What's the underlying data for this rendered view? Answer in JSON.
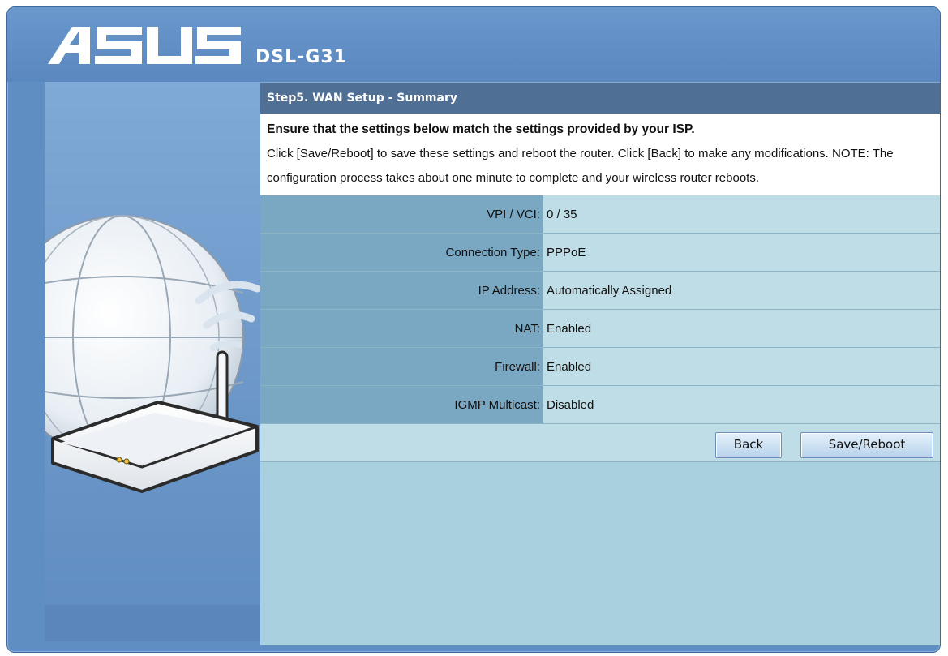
{
  "header": {
    "brand": "ASUS",
    "model": "DSL-G31"
  },
  "step": {
    "title": "Step5. WAN Setup - Summary"
  },
  "intro": {
    "headline": "Ensure that the settings below match the settings provided by your ISP.",
    "body": "Click [Save/Reboot] to save these settings and reboot the router. Click [Back] to make any modifications. NOTE: The configuration process takes about one minute to complete and your wireless router reboots."
  },
  "summary": {
    "rows": [
      {
        "label": "VPI / VCI:",
        "value": "0 / 35"
      },
      {
        "label": "Connection Type:",
        "value": "PPPoE"
      },
      {
        "label": "IP Address:",
        "value": "Automatically Assigned"
      },
      {
        "label": "NAT:",
        "value": "Enabled"
      },
      {
        "label": "Firewall:",
        "value": "Enabled"
      },
      {
        "label": "IGMP Multicast:",
        "value": "Disabled"
      }
    ]
  },
  "buttons": {
    "back_label": "Back",
    "save_label": "Save/Reboot"
  },
  "colors": {
    "header_blue": "#5f8ec2",
    "step_bar": "#4f6f95",
    "label_cell": "#7aa7c2",
    "value_cell": "#bfdde6"
  }
}
